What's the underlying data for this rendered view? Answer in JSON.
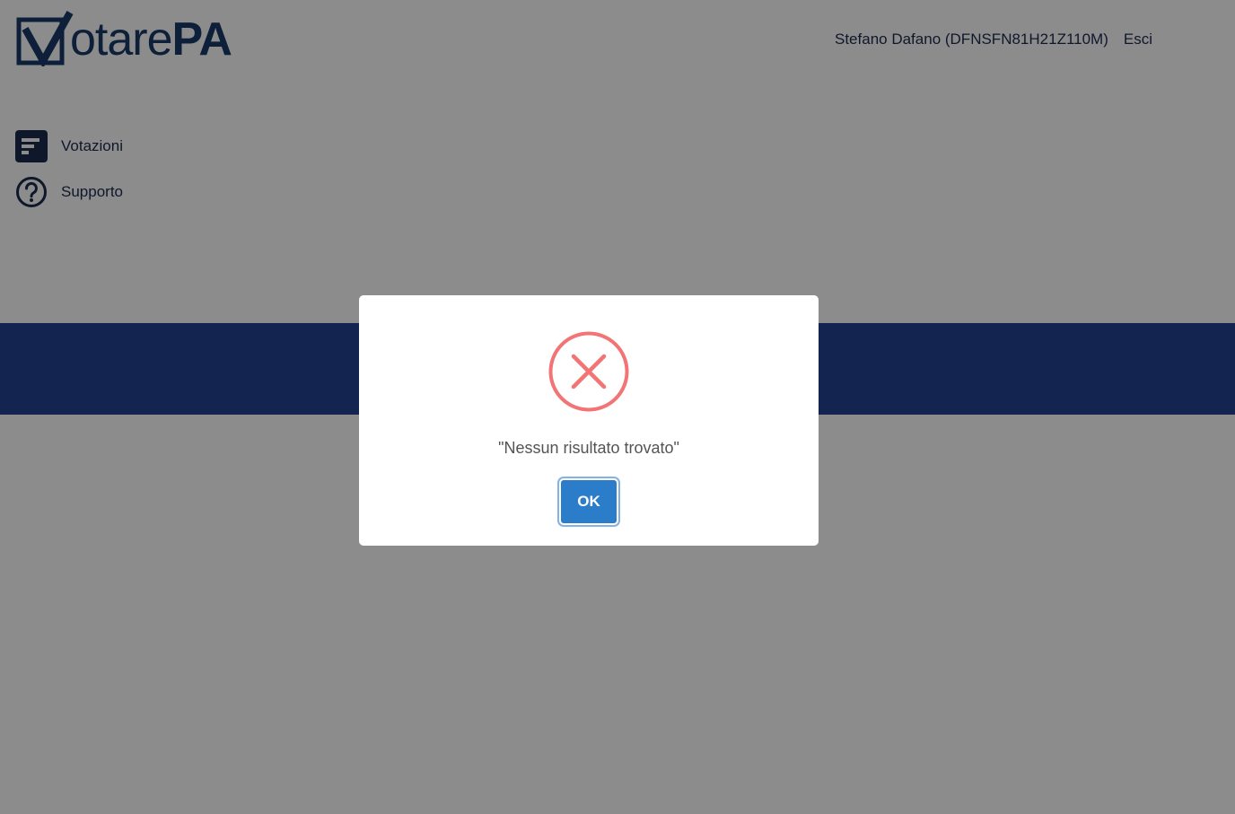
{
  "header": {
    "logo_text_main": "otare",
    "logo_text_bold": "PA",
    "user_name": "Stefano Dafano (DFNSFN81H21Z110M)",
    "logout_label": "Esci"
  },
  "sidebar": {
    "items": [
      {
        "label": "Votazioni",
        "icon": "list-icon"
      },
      {
        "label": "Supporto",
        "icon": "help-circle-icon"
      }
    ]
  },
  "dialog": {
    "icon": "error-x-icon",
    "message": "\"Nessun risultato trovato\"",
    "ok_label": "OK"
  },
  "colors": {
    "brand_navy": "#1b3a6b",
    "banner": "#264394",
    "error": "#f27474",
    "ok_button": "#2c7dc9"
  }
}
